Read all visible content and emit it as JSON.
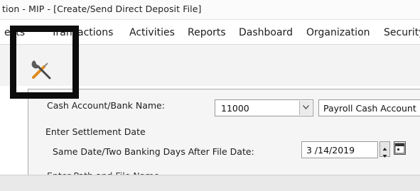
{
  "window": {
    "title": "tion - MIP - [Create/Send Direct Deposit File]"
  },
  "menu": {
    "items": [
      {
        "label": "ects",
        "name": "menu-item-objects"
      },
      {
        "label": "Transactions",
        "name": "menu-item-transactions"
      },
      {
        "label": "Activities",
        "name": "menu-item-activities"
      },
      {
        "label": "Reports",
        "name": "menu-item-reports"
      },
      {
        "label": "Dashboard",
        "name": "menu-item-dashboard"
      },
      {
        "label": "Organization",
        "name": "menu-item-organization"
      },
      {
        "label": "Security",
        "name": "menu-item-security"
      }
    ]
  },
  "toolbar": {
    "tool_icon": "tools-icon"
  },
  "form": {
    "bank_account_label": "Cash Account/Bank Name:",
    "bank_account_code": "11000",
    "bank_account_name": "Payroll Cash Account",
    "settlement_heading": "Enter Settlement Date",
    "settlement_date_label": "Same Date/Two Banking Days After File Date:",
    "settlement_date_value": "3 /14/2019",
    "path_heading": "Enter Path and File Name"
  },
  "colors": {
    "highlight_box": "#0d0d0d",
    "panel_background": "#f5f5f5",
    "toolbar_background": "#f3f3f3"
  }
}
